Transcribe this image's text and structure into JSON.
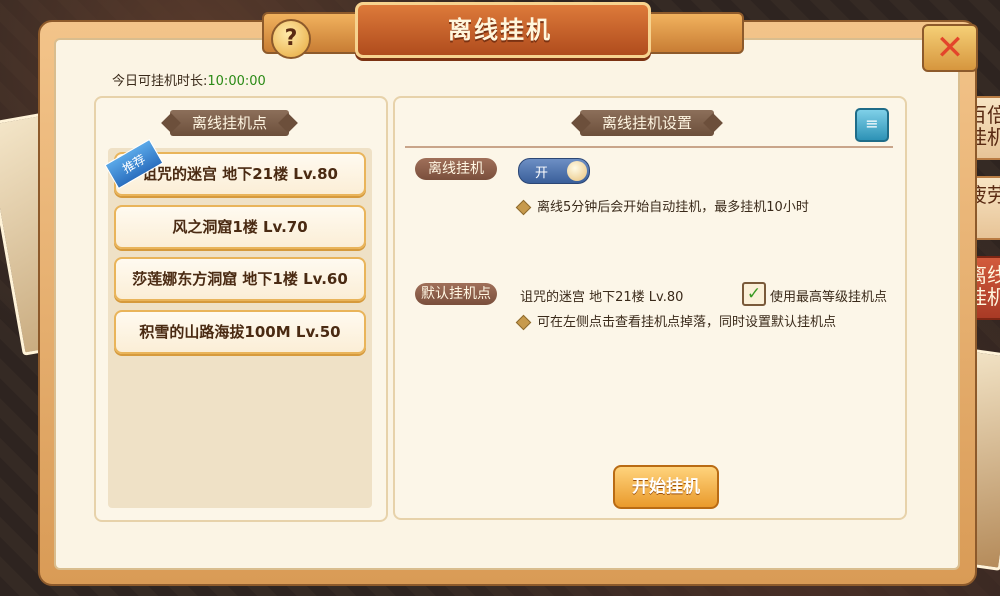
{
  "dialog": {
    "title": "离线挂机",
    "help_label": "?",
    "close_label": "✕",
    "today_time_label": "今日可挂机时长:",
    "today_time_value": "10:00:00"
  },
  "left_panel": {
    "header": "离线挂机点",
    "recommend_badge": "推荐",
    "locations": [
      {
        "label": "诅咒的迷宫 地下21楼 Lv.80"
      },
      {
        "label": "风之洞窟1楼 Lv.70"
      },
      {
        "label": "莎莲娜东方洞窟 地下1楼 Lv.60"
      },
      {
        "label": "积雪的山路海拔100M Lv.50"
      }
    ]
  },
  "right_panel": {
    "header": "离线挂机设置",
    "offline_label": "离线挂机",
    "toggle_text": "开",
    "offline_hint": "离线5分钟后会开始自动挂机，最多挂机10小时",
    "default_label": "默认挂机点",
    "default_value": "诅咒的迷宫 地下21楼 Lv.80",
    "use_highest_label": "使用最高等级挂机点",
    "use_highest_checked": true,
    "default_hint": "可在左侧点击查看挂机点掉落，同时设置默认挂机点",
    "start_button": "开始挂机"
  },
  "side_tabs": [
    {
      "label": "百倍 挂机"
    },
    {
      "label": "疲劳"
    },
    {
      "label": "离线 挂机"
    }
  ],
  "colors": {
    "accent": "#e99a2c",
    "time_value": "#2a8a16",
    "toggle_on": "#3a5f9a"
  },
  "icons": {
    "help": "question-icon",
    "close": "close-icon",
    "doc": "document-search-icon",
    "bullet": "diamond-icon",
    "check": "checkmark-icon"
  }
}
